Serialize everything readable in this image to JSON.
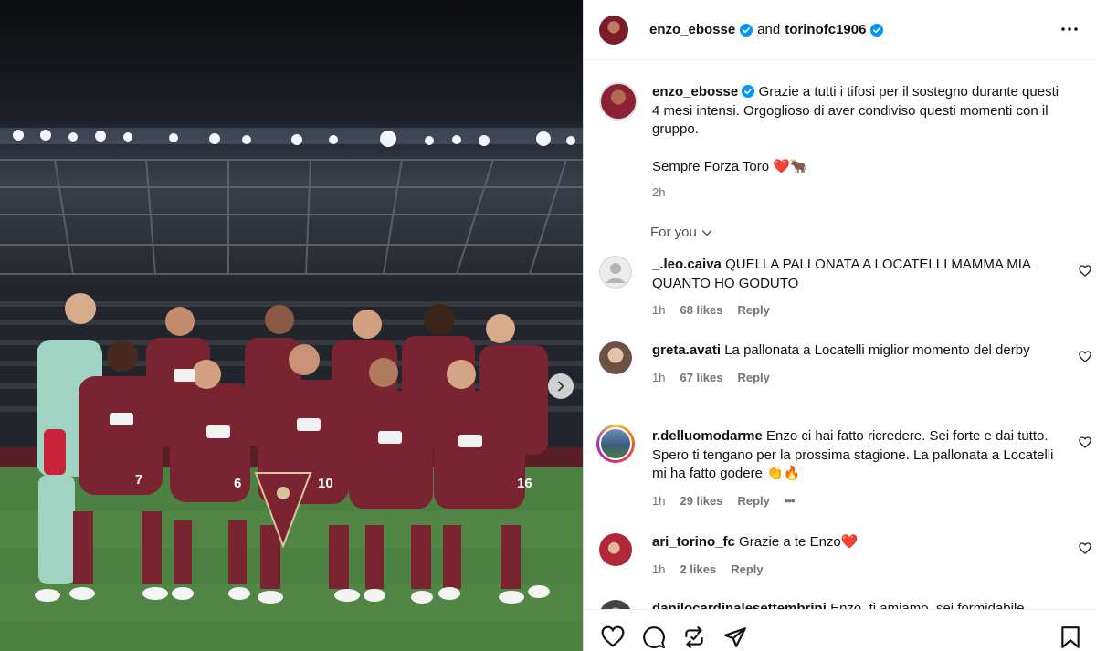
{
  "header": {
    "author": "enzo_ebosse",
    "connector": "and",
    "collaborator": "torinofc1906"
  },
  "caption": {
    "username": "enzo_ebosse",
    "text": "Grazie a tutti i tifosi per il sostegno durante questi 4 mesi intensi. Orgoglioso di aver condiviso questi momenti con il gruppo.",
    "text2": "Sempre Forza Toro ❤️🐂",
    "time": "2h"
  },
  "filter": {
    "label": "For you"
  },
  "comments": [
    {
      "username": "_.leo.caiva",
      "text": "QUELLA PALLONATA A LOCATELLI MAMMA MIA QUANTO HO GODUTO",
      "time": "1h",
      "likes": "68 likes",
      "reply": "Reply"
    },
    {
      "username": "greta.avati",
      "text": "La pallonata a Locatelli miglior momento del derby",
      "time": "1h",
      "likes": "67 likes",
      "reply": "Reply"
    },
    {
      "username": "r.delluomodarme",
      "text": "Enzo ci hai fatto ricredere. Sei forte e dai tutto. Spero ti tengano per la prossima stagione. La pallonata a Locatelli mi ha fatto godere 👏🔥",
      "time": "1h",
      "likes": "29 likes",
      "reply": "Reply",
      "more": "•••"
    },
    {
      "username": "ari_torino_fc",
      "text": "Grazie a te Enzo❤️",
      "time": "1h",
      "likes": "2 likes",
      "reply": "Reply"
    },
    {
      "username": "danilocardinalesettembrini",
      "text": "Enzo, ti amiamo, sei formidabile"
    }
  ],
  "photo": {
    "jersey_numbers": [
      "7",
      "6",
      "10",
      "16"
    ]
  },
  "icons": {
    "like": "heart-icon",
    "comment": "comment-icon",
    "repost": "repost-icon",
    "share": "share-icon",
    "save": "bookmark-icon",
    "more": "more-options-icon",
    "next": "chevron-right-icon"
  },
  "colors": {
    "verified": "#0095f6",
    "kit": "#7b2431",
    "pitch": "#4a7c40"
  }
}
